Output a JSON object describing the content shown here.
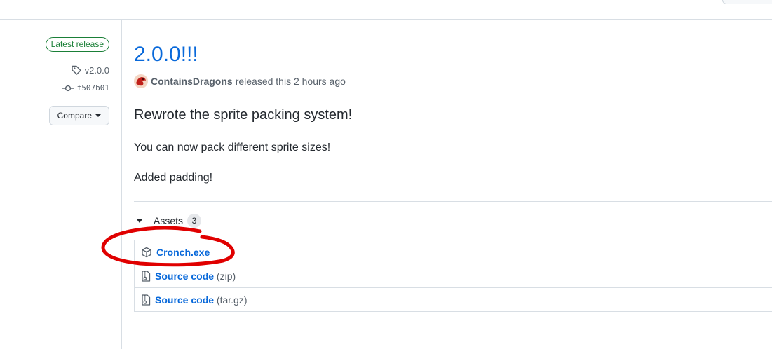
{
  "sidebar": {
    "badge": "Latest release",
    "tag": "v2.0.0",
    "commit": "f507b01",
    "compare_label": "Compare"
  },
  "release": {
    "title": "2.0.0!!!",
    "author": "ContainsDragons",
    "released_text": "released this 2 hours ago",
    "notes": {
      "heading": "Rewrote the sprite packing system!",
      "line1": "You can now pack different sprite sizes!",
      "line2": "Added padding!"
    }
  },
  "assets": {
    "label": "Assets",
    "count": "3",
    "items": [
      {
        "name": "Cronch.exe",
        "suffix": "",
        "icon": "package-icon"
      },
      {
        "name": "Source code",
        "suffix": "(zip)",
        "icon": "file-zip-icon"
      },
      {
        "name": "Source code",
        "suffix": "(tar.gz)",
        "icon": "file-zip-icon"
      }
    ]
  },
  "colors": {
    "link": "#0969da",
    "latest_green": "#1a7f37",
    "annotation_red": "#e00000"
  }
}
